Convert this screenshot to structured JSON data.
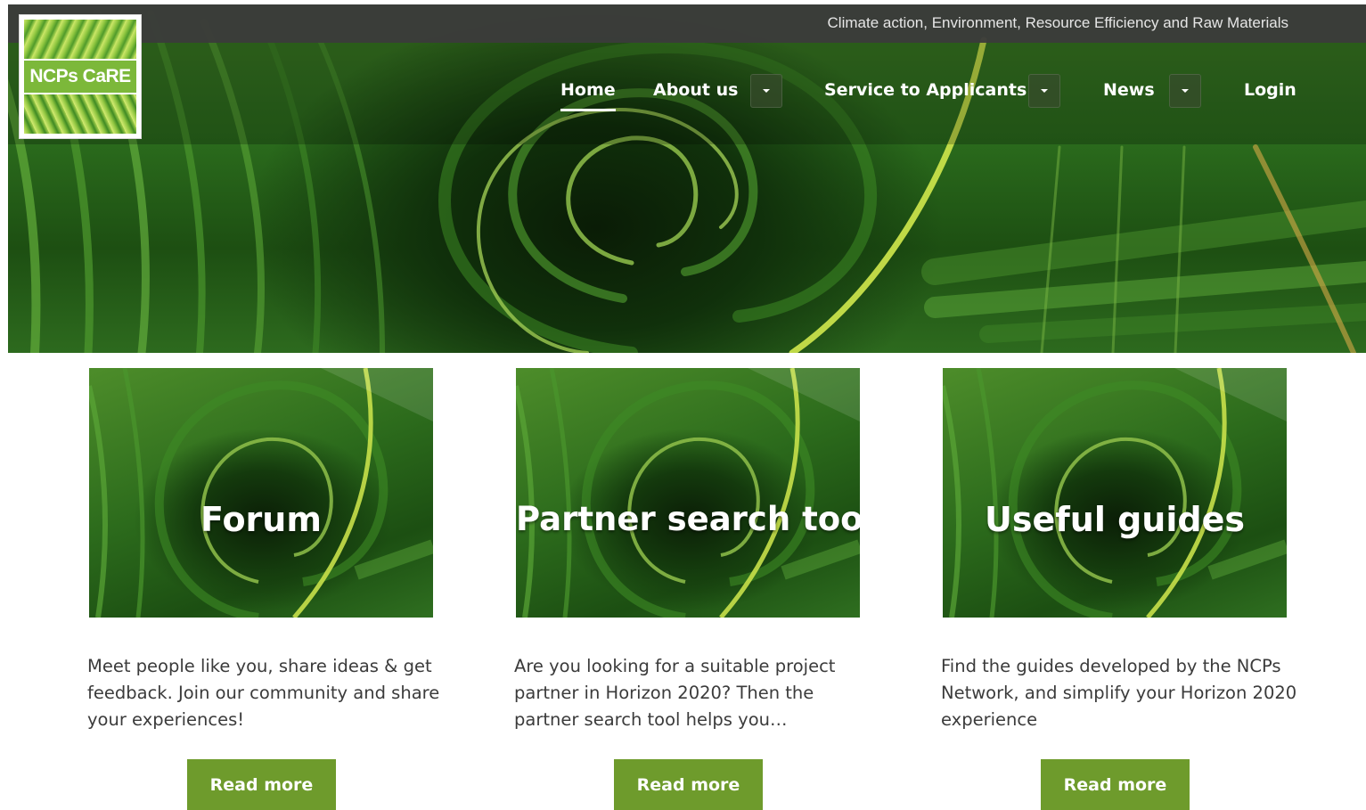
{
  "header": {
    "tagline": "Climate action, Environment, Resource Efficiency and Raw Materials",
    "logo_text": "NCPs CaRE"
  },
  "nav": {
    "items": [
      {
        "label": "Home",
        "active": true,
        "has_dropdown": false
      },
      {
        "label": "About us",
        "active": false,
        "has_dropdown": true
      },
      {
        "label": "Service to Applicants",
        "active": false,
        "has_dropdown": true
      },
      {
        "label": "News",
        "active": false,
        "has_dropdown": true
      },
      {
        "label": "Login",
        "active": false,
        "has_dropdown": false
      }
    ]
  },
  "cards": [
    {
      "title": "Forum",
      "text": "Meet people like you, share ideas & get feedback. Join our community and share your experiences!",
      "button": "Read more"
    },
    {
      "title": "Partner search tool",
      "text": "Are you looking for a suitable project partner in Horizon 2020? Then the partner search tool helps you…",
      "button": "Read more"
    },
    {
      "title": "Useful guides",
      "text": "Find the guides developed by the NCPs Network, and simplify your Horizon 2020 experience",
      "button": "Read more"
    }
  ],
  "colors": {
    "topbar": "#3a3a3a",
    "button_green": "#6e9b2c",
    "hero_green": "#2a6a1c",
    "accent_lime": "#b5d63c"
  },
  "icons": {
    "dropdown": "caret-down-icon"
  }
}
